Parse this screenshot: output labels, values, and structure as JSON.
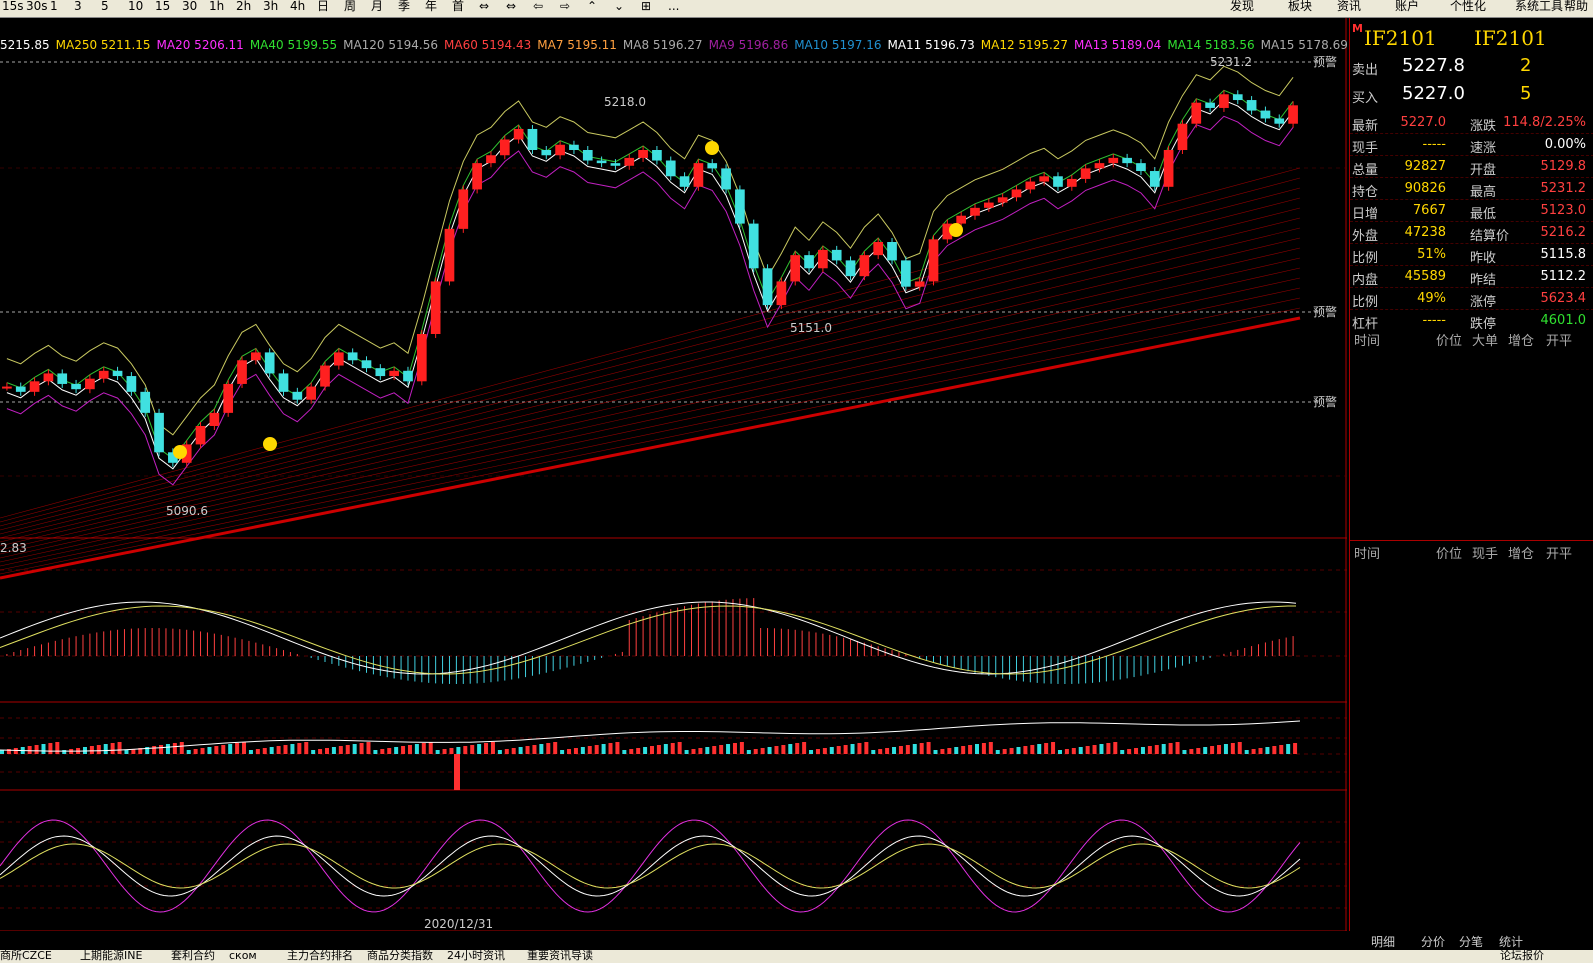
{
  "toolbar": {
    "periods": [
      "15s",
      "30s",
      "1",
      "3",
      "5",
      "10",
      "15",
      "30",
      "1h",
      "2h",
      "3h",
      "4h",
      "日",
      "周",
      "月",
      "季",
      "年",
      "首",
      "⇔",
      "⇔",
      "⇦",
      "⇨",
      "⌃",
      "⌄",
      "⊞",
      "..."
    ],
    "menu": [
      "发现",
      "板块",
      "资讯",
      "账户",
      "个性化",
      "系统工具",
      "帮助"
    ]
  },
  "ma_legend": [
    {
      "label": "5215.85",
      "color": "#ffffff"
    },
    {
      "label": "MA250 5211.15",
      "color": "#ffd700"
    },
    {
      "label": "MA20 5206.11",
      "color": "#ff30ff"
    },
    {
      "label": "MA40 5199.55",
      "color": "#30e030"
    },
    {
      "label": "MA120 5194.56",
      "color": "#aaaaaa"
    },
    {
      "label": "MA60 5194.43",
      "color": "#ff4040"
    },
    {
      "label": "MA7 5195.11",
      "color": "#ffa040"
    },
    {
      "label": "MA8 5196.27",
      "color": "#aaaaaa"
    },
    {
      "label": "MA9 5196.86",
      "color": "#a020a0"
    },
    {
      "label": "MA10 5197.16",
      "color": "#2090d0"
    },
    {
      "label": "MA11 5196.73",
      "color": "#ffffff"
    },
    {
      "label": "MA12 5195.27",
      "color": "#ffd700"
    },
    {
      "label": "MA13 5189.04",
      "color": "#ff30ff"
    },
    {
      "label": "MA14 5183.56",
      "color": "#30e030"
    },
    {
      "label": "MA15 5178.69",
      "color": "#aaaaaa"
    }
  ],
  "chart_labels": {
    "high1": "5218.0",
    "low1": "5090.6",
    "low2": "5151.0",
    "high2": "5231.2",
    "alert": "预警",
    "macd_value": "2.83",
    "date": "2020/12/31"
  },
  "quote": {
    "symbol_left": "IF2101",
    "symbol_right": "IF2101",
    "m_mark": "M",
    "sell_label": "卖出",
    "sell_price": "5227.8",
    "sell_vol": "2",
    "buy_label": "买入",
    "buy_price": "5227.0",
    "buy_vol": "5",
    "rows": [
      {
        "l1": "最新",
        "v1": "5227.0",
        "c1": "#ff4040",
        "l2": "涨跌",
        "v2": "114.8/2.25%",
        "c2": "#ff4040"
      },
      {
        "l1": "现手",
        "v1": "-----",
        "c1": "#ffd700",
        "l2": "速涨",
        "v2": "0.00%",
        "c2": "#ffffff"
      },
      {
        "l1": "总量",
        "v1": "92827",
        "c1": "#ffd700",
        "l2": "开盘",
        "v2": "5129.8",
        "c2": "#ff4040"
      },
      {
        "l1": "持仓",
        "v1": "90826",
        "c1": "#ffd700",
        "l2": "最高",
        "v2": "5231.2",
        "c2": "#ff4040"
      },
      {
        "l1": "日增",
        "v1": "7667",
        "c1": "#ffd700",
        "l2": "最低",
        "v2": "5123.0",
        "c2": "#ff4040"
      },
      {
        "l1": "外盘",
        "v1": "47238",
        "c1": "#ffd700",
        "l2": "结算价",
        "v2": "5216.2",
        "c2": "#ff4040"
      },
      {
        "l1": "比例",
        "v1": "51%",
        "c1": "#ffd700",
        "l2": "昨收",
        "v2": "5115.8",
        "c2": "#ffffff"
      },
      {
        "l1": "内盘",
        "v1": "45589",
        "c1": "#ffd700",
        "l2": "昨结",
        "v2": "5112.2",
        "c2": "#ffffff"
      },
      {
        "l1": "比例",
        "v1": "49%",
        "c1": "#ffd700",
        "l2": "涨停",
        "v2": "5623.4",
        "c2": "#ff4040"
      },
      {
        "l1": "杠杆",
        "v1": "-----",
        "c1": "#ffd700",
        "l2": "跌停",
        "v2": "4601.0",
        "c2": "#30e030"
      }
    ],
    "header1": [
      "时间",
      "价位",
      "大单",
      "增仓",
      "开平"
    ],
    "header2": [
      "时间",
      "价位",
      "现手",
      "增仓",
      "开平"
    ],
    "bottom_tabs": [
      "明细",
      "分价",
      "分笔",
      "统计"
    ]
  },
  "bottom_bar": [
    "商所CZCE",
    "上期能源INE",
    "套利合约",
    "ском",
    "主力合约排名",
    "商品分类指数",
    "24小时资讯",
    "重要资讯导读",
    "论坛报价"
  ],
  "chart_data": {
    "type": "candlestick",
    "symbol": "IF2101",
    "x": [
      "2020/12/31"
    ],
    "price_labels": {
      "marked_high_1": 5218.0,
      "marked_low_1": 5090.6,
      "marked_low_2": 5151.0,
      "marked_high_2": 5231.2
    },
    "price_path": [
      5120,
      5118,
      5122,
      5125,
      5121,
      5119,
      5123,
      5126,
      5124,
      5118,
      5110,
      5095,
      5091,
      5098,
      5105,
      5110,
      5121,
      5130,
      5133,
      5125,
      5118,
      5115,
      5120,
      5128,
      5133,
      5130,
      5127,
      5124,
      5126,
      5122,
      5140,
      5160,
      5180,
      5195,
      5205,
      5208,
      5214,
      5218,
      5210,
      5208,
      5212,
      5210,
      5206,
      5205,
      5204,
      5207,
      5210,
      5206,
      5200,
      5196,
      5205,
      5203,
      5195,
      5182,
      5165,
      5151,
      5160,
      5170,
      5165,
      5172,
      5168,
      5162,
      5170,
      5175,
      5168,
      5158,
      5160,
      5176,
      5182,
      5185,
      5188,
      5190,
      5192,
      5195,
      5198,
      5200,
      5196,
      5199,
      5203,
      5205,
      5207,
      5205,
      5202,
      5196,
      5210,
      5220,
      5228,
      5226,
      5231.2,
      5229,
      5225,
      5222,
      5220,
      5227
    ]
  }
}
